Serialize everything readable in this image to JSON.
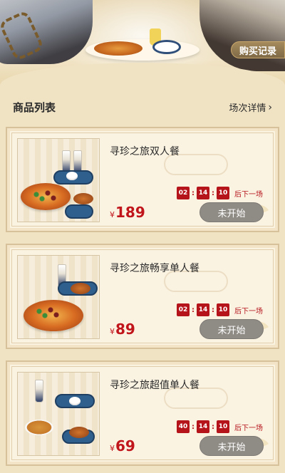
{
  "header": {
    "buy_record_label": "购买记录"
  },
  "list": {
    "title": "商品列表",
    "session_details_label": "场次详情"
  },
  "products": [
    {
      "name": "寻珍之旅双人餐",
      "currency": "¥",
      "price": "189",
      "countdown": [
        "02",
        "14",
        "10"
      ],
      "next_session": "后下一场",
      "status": "未开始"
    },
    {
      "name": "寻珍之旅畅享单人餐",
      "currency": "¥",
      "price": "89",
      "countdown": [
        "02",
        "14",
        "10"
      ],
      "next_session": "后下一场",
      "status": "未开始"
    },
    {
      "name": "寻珍之旅超值单人餐",
      "currency": "¥",
      "price": "69",
      "countdown": [
        "40",
        "14",
        "10"
      ],
      "next_session": "后下一场",
      "status": "未开始"
    }
  ],
  "icons": {
    "chevron": "chevron-right-icon"
  },
  "colors": {
    "accent_red": "#b5141b",
    "button_gray": "#8f8b85",
    "background": "#f0e3c4"
  }
}
